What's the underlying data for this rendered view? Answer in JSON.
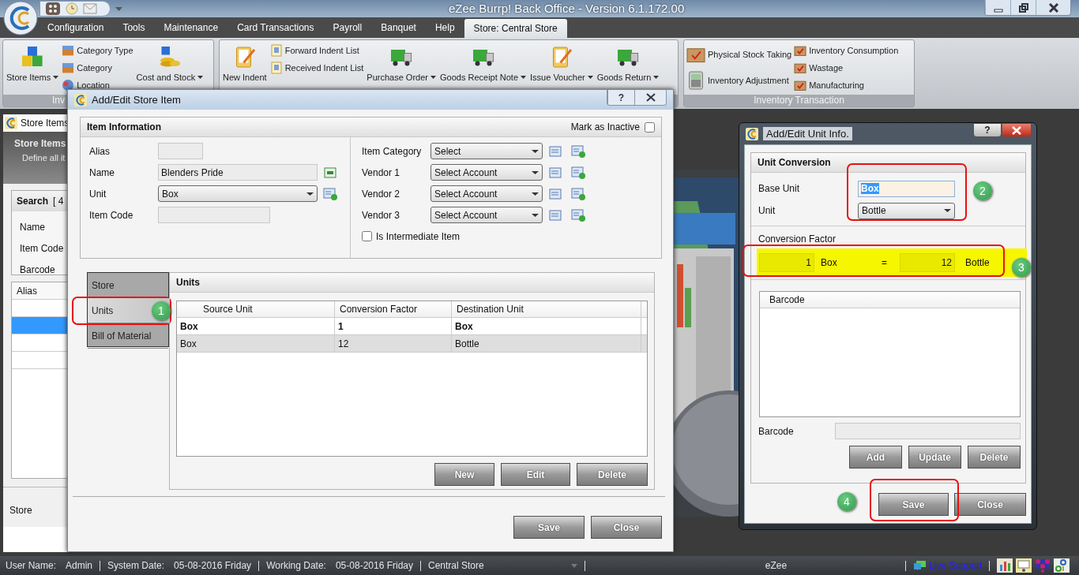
{
  "title_bar": {
    "title": "eZee Burrp! Back Office - Version 6.1.172.00"
  },
  "menu_tabs": [
    {
      "label": "Configuration",
      "selected": false
    },
    {
      "label": "Tools",
      "selected": false
    },
    {
      "label": "Maintenance",
      "selected": false
    },
    {
      "label": "Card Transactions",
      "selected": false
    },
    {
      "label": "Payroll",
      "selected": false
    },
    {
      "label": "Banquet",
      "selected": false
    },
    {
      "label": "Help",
      "selected": false
    },
    {
      "label": "Store: Central Store",
      "selected": true
    }
  ],
  "ribbon": {
    "groups": [
      {
        "label": "Inv",
        "columns": [
          {
            "items": [
              {
                "label": "Store Items",
                "kind": "large",
                "dropdown": true
              }
            ]
          },
          {
            "items": [
              {
                "label": "Category Type",
                "kind": "small"
              },
              {
                "label": "Category",
                "kind": "small"
              },
              {
                "label": "Location",
                "kind": "small"
              }
            ]
          },
          {
            "items": [
              {
                "label": "Cost and Stock",
                "kind": "large",
                "dropdown": true
              }
            ]
          }
        ]
      },
      {
        "columns": [
          {
            "items": [
              {
                "label": "New Indent",
                "kind": "large",
                "dropdown": false
              }
            ]
          },
          {
            "items": [
              {
                "label": "Forward Indent List",
                "kind": "small"
              },
              {
                "label": "Received Indent List",
                "kind": "small"
              }
            ]
          },
          {
            "items": [
              {
                "label": "Purchase Order",
                "kind": "large",
                "dropdown": true
              }
            ]
          },
          {
            "items": [
              {
                "label": "Goods Receipt Note",
                "kind": "large",
                "dropdown": true
              }
            ]
          },
          {
            "items": [
              {
                "label": "Issue Voucher",
                "kind": "large",
                "dropdown": true
              }
            ]
          },
          {
            "items": [
              {
                "label": "Goods Return",
                "kind": "large",
                "dropdown": true
              }
            ]
          }
        ]
      },
      {
        "label": "Inventory Transaction",
        "columns": [
          {
            "items": [
              {
                "label": "Physical Stock Taking",
                "kind": "medium"
              },
              {
                "label": "Inventory Adjustment",
                "kind": "medium"
              }
            ]
          },
          {
            "items": [
              {
                "label": "Inventory Consumption",
                "kind": "small"
              },
              {
                "label": "Wastage",
                "kind": "small"
              },
              {
                "label": "Manufacturing",
                "kind": "small"
              }
            ]
          }
        ]
      }
    ]
  },
  "store_items_window": {
    "title": "Store Items",
    "header_title": "Store Items",
    "header_subtitle": "Define all it",
    "search_title": "Search",
    "search_count": "[ 4",
    "fields": [
      {
        "label": "Name"
      },
      {
        "label": "Item Code"
      },
      {
        "label": "Barcode"
      }
    ],
    "grid_column": "Alias",
    "grid_rows": [
      {
        "selected": false
      },
      {
        "selected": true
      },
      {
        "selected": false
      },
      {
        "selected": false
      }
    ],
    "store_label": "Store"
  },
  "item_dialog": {
    "title": "Add/Edit Store Item",
    "help_button": "?",
    "section_title": "Item Information",
    "inactive": {
      "label": "Mark as Inactive",
      "checked": false
    },
    "left_fields": [
      {
        "label": "Alias",
        "kind": "short"
      },
      {
        "label": "Name",
        "kind": "text",
        "value": "Blenders Pride"
      },
      {
        "label": "Unit",
        "kind": "select",
        "value": "Box"
      },
      {
        "label": "Item Code",
        "kind": "medium"
      }
    ],
    "right_fields": [
      {
        "label": "Item Category",
        "value": "Select"
      },
      {
        "label": "Vendor 1",
        "value": "Select Account"
      },
      {
        "label": "Vendor 2",
        "value": "Select Account"
      },
      {
        "label": "Vendor 3",
        "value": "Select Account"
      }
    ],
    "intermediate": {
      "label": "Is Intermediate Item",
      "checked": false
    },
    "side_tabs": [
      {
        "label": "Store",
        "selected": false
      },
      {
        "label": "Units",
        "selected": true
      },
      {
        "label": "Bill of Material",
        "selected": false
      }
    ],
    "panel_title": "Units",
    "table": {
      "columns": [
        "Source Unit",
        "Conversion Factor",
        "Destination Unit"
      ],
      "rows": [
        {
          "cells": [
            "Box",
            "1",
            "Box"
          ],
          "bold": true,
          "selected": false
        },
        {
          "cells": [
            "Box",
            "12",
            "Bottle"
          ],
          "bold": false,
          "selected": true
        }
      ]
    },
    "table_buttons": [
      "New",
      "Edit",
      "Delete"
    ],
    "buttons": [
      "Save",
      "Close"
    ]
  },
  "unit_dialog": {
    "title": "Add/Edit Unit Info.",
    "help_button": "?",
    "section_title": "Unit Conversion",
    "base_unit": {
      "label": "Base Unit",
      "value": "Box"
    },
    "unit": {
      "label": "Unit",
      "value": "Bottle"
    },
    "conversion": {
      "label": "Conversion Factor",
      "from_value": "1",
      "from_unit": "Box",
      "equals": "=",
      "to_value": "12",
      "to_unit": "Bottle"
    },
    "barcode_list": {
      "column": "Barcode"
    },
    "barcode_field": {
      "label": "Barcode"
    },
    "list_buttons": [
      "Add",
      "Update",
      "Delete"
    ],
    "buttons": [
      "Save",
      "Close"
    ]
  },
  "annotations": [
    {
      "number": "1"
    },
    {
      "number": "2"
    },
    {
      "number": "3"
    },
    {
      "number": "4"
    }
  ],
  "status_bar": {
    "fields": [
      {
        "label": "User Name:",
        "value": "Admin"
      },
      {
        "label": "System Date:",
        "value": "05-08-2016 Friday"
      },
      {
        "label": "Working Date:",
        "value": "05-08-2016 Friday"
      }
    ],
    "store": "Central Store",
    "center": "eZee",
    "support": "Live Support"
  }
}
